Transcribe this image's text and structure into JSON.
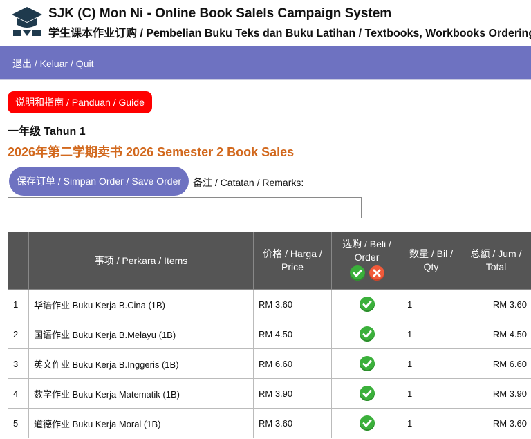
{
  "header": {
    "title": "SJK (C) Mon Ni - Online Book Salels Campaign System",
    "subtitle": "学生课本作业订购 / Pembelian Buku Teks dan Buku Latihan / Textbooks, Workbooks Ordering",
    "logo_icon": "graduation-cap-icon"
  },
  "nav": {
    "quit_label": "退出 / Keluar / Quit"
  },
  "guide_button": "说明和指南 / Panduan / Guide",
  "grade_label": "一年级 Tahun 1",
  "campaign_title": "2026年第二学期卖书 2026 Semester 2 Book Sales",
  "save_button": "保存订单 / Simpan Order / Save Order",
  "remarks": {
    "label": "备注 / Catatan / Remarks:",
    "value": ""
  },
  "table": {
    "headers": {
      "no": "",
      "item": "事项 / Perkara / Items",
      "price": "价格 / Harga / Price",
      "order": "选购 / Beli / Order",
      "qty": "数量 / Bil / Qty",
      "total": "总额 / Jum / Total"
    },
    "rows": [
      {
        "no": "1",
        "item": "华语作业 Buku Kerja B.Cina (1B)",
        "price": "RM 3.60",
        "ordered": true,
        "qty": "1",
        "total": "RM 3.60"
      },
      {
        "no": "2",
        "item": "国语作业 Buku Kerja B.Melayu (1B)",
        "price": "RM 4.50",
        "ordered": true,
        "qty": "1",
        "total": "RM 4.50"
      },
      {
        "no": "3",
        "item": "英文作业 Buku Kerja B.Inggeris (1B)",
        "price": "RM 6.60",
        "ordered": true,
        "qty": "1",
        "total": "RM 6.60"
      },
      {
        "no": "4",
        "item": "数学作业 Buku Kerja Matematik (1B)",
        "price": "RM 3.90",
        "ordered": true,
        "qty": "1",
        "total": "RM 3.90"
      },
      {
        "no": "5",
        "item": "道德作业 Buku Kerja Moral (1B)",
        "price": "RM 3.60",
        "ordered": true,
        "qty": "1",
        "total": "RM 3.60"
      }
    ]
  },
  "colors": {
    "nav_bg": "#6e72c1",
    "guide_bg": "#ff0000",
    "campaign_text": "#d2691e",
    "table_header_bg": "#555555",
    "check": "#3bb03b",
    "cross": "#f05a3a"
  }
}
